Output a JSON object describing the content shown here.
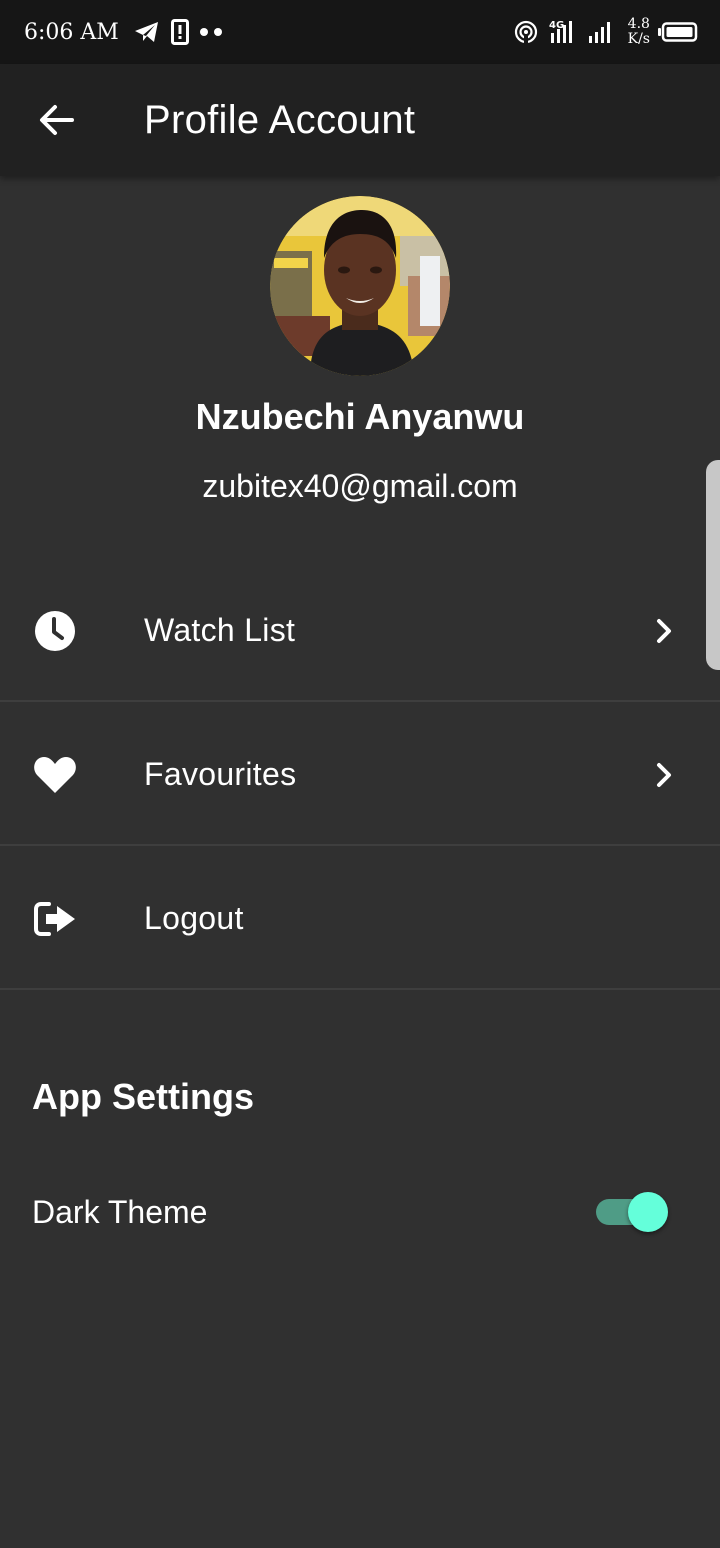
{
  "status_bar": {
    "time": "6:06 AM",
    "network_speed_value": "4.8",
    "network_speed_unit": "K/s",
    "signal_label": "4G",
    "icons": [
      "telegram-icon",
      "phone-icon",
      "more-dots-icon",
      "hotspot-icon",
      "signal-4g-icon",
      "signal-icon",
      "battery-icon"
    ]
  },
  "app_bar": {
    "title": "Profile Account",
    "back_icon": "arrow-back-icon"
  },
  "profile": {
    "name": "Nzubechi Anyanwu",
    "email": "zubitex40@gmail.com"
  },
  "menu": {
    "items": [
      {
        "label": "Watch List",
        "icon": "clock-icon",
        "has_chevron": true
      },
      {
        "label": "Favourites",
        "icon": "heart-icon",
        "has_chevron": true
      },
      {
        "label": "Logout",
        "icon": "logout-icon",
        "has_chevron": false
      }
    ]
  },
  "settings": {
    "heading": "App Settings",
    "dark_theme": {
      "label": "Dark Theme",
      "enabled": true
    }
  },
  "colors": {
    "background": "#303030",
    "app_bar": "#212121",
    "status_bar": "#161616",
    "toggle_thumb": "#64ffda",
    "toggle_track": "#4f9c86",
    "divider": "#3e3e3e"
  }
}
